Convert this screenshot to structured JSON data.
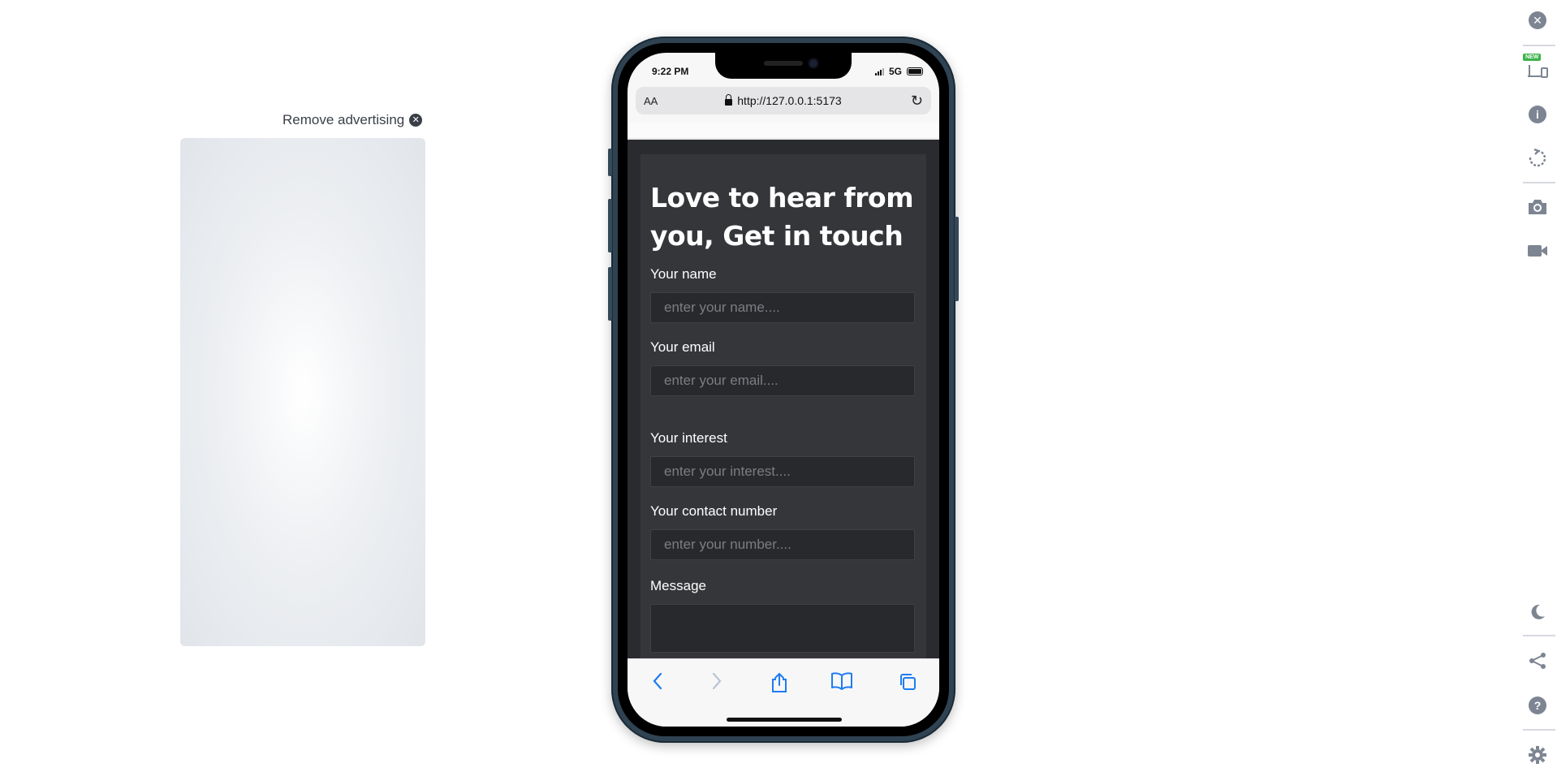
{
  "ad": {
    "remove_label": "Remove advertising"
  },
  "phone": {
    "status_time": "9:22 PM",
    "network": "5G",
    "browser": {
      "aa_label": "AA",
      "url": "http://127.0.0.1:5173"
    }
  },
  "form": {
    "heading": "Love to hear from you, Get in touch",
    "name_label": "Your name",
    "name_placeholder": "enter your name....",
    "email_label": "Your email",
    "email_placeholder": "enter your email....",
    "interest_label": "Your interest",
    "interest_placeholder": "enter your interest....",
    "contact_label": "Your contact number",
    "contact_placeholder": "enter your number....",
    "message_label": "Message"
  },
  "sidebar": {
    "new_badge": "NEW"
  },
  "colors": {
    "accent": "#1e7cf2",
    "form_bg": "#35363a",
    "page_bg": "#2a2b2e",
    "sidebar_icon": "#7d8592",
    "badge_new": "#3cb34a"
  }
}
